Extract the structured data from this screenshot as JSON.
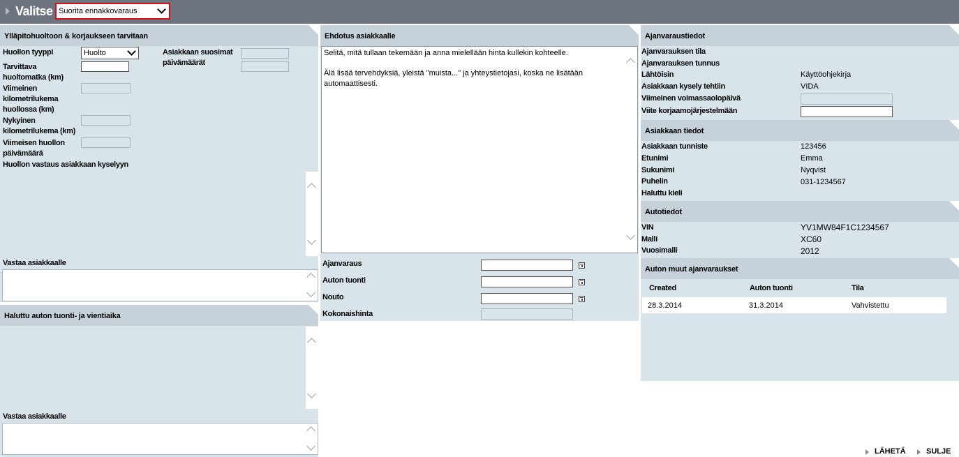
{
  "header": {
    "title": "Valitse",
    "select_value": "Suorita ennakkovaraus"
  },
  "maintenance": {
    "title": "Ylläpitohuoltoon & korjaukseen tarvitaan",
    "service_type_label": "Huollon tyyppi",
    "service_type_value": "Huolto",
    "required_km_label": "Tarvittava huoltomatka (km)",
    "last_km_label": "Viimeinen kilometrilukema huollossa (km)",
    "current_km_label": "Nykyinen kilometrilukema (km)",
    "last_date_label": "Viimeisen huollon päivämäärä",
    "preferred_dates_label": "Asiakkaan suosimat päivämäärät",
    "response_label": "Huollon vastaus asiakkaan kyselyyn",
    "reply_label": "Vastaa asiakkaalle"
  },
  "delivery": {
    "title": "Haluttu auton tuonti- ja vientiaika",
    "reply_label": "Vastaa asiakkaalle"
  },
  "proposal": {
    "title": "Ehdotus asiakkaalle",
    "text_line1": "Selitä, mitä tullaan tekemään ja anna mielellään hinta kullekin kohteelle.",
    "text_line2": "Älä lisää tervehdyksiä, yleistä \"muista...\" ja yhteystietojasi, koska ne lisätään automaattisesti.",
    "booking_label": "Ajanvaraus",
    "dropoff_label": "Auton tuonti",
    "pickup_label": "Nouto",
    "total_label": "Kokonaishinta"
  },
  "booking_info": {
    "title": "Ajanvaraustiedot",
    "status_label": "Ajanvarauksen tila",
    "id_label": "Ajanvarauksen tunnus",
    "source_label": "Lähtöisin",
    "source_value": "Käyttöohjekirja",
    "query_label": "Asiakkaan kysely tehtiin",
    "query_value": "VIDA",
    "expiry_label": "Viimeinen voimassaolopäivä",
    "ref_label": "Viite korjaamojärjestelmään"
  },
  "customer": {
    "title": "Asiakkaan tiedot",
    "id_label": "Asiakkaan tunniste",
    "id_value": "123456",
    "first_label": "Etunimi",
    "first_value": "Emma",
    "last_label": "Sukunimi",
    "last_value": "Nyqvist",
    "phone_label": "Puhelin",
    "phone_value": "031-1234567",
    "lang_label": "Haluttu kieli"
  },
  "car": {
    "title": "Autotiedot",
    "vin_label": "VIN",
    "vin_value": "YV1MW84F1C1234567",
    "model_label": "Malli",
    "model_value": "XC60",
    "year_label": "Vuosimalli",
    "year_value": "2012"
  },
  "other_bookings": {
    "title": "Auton muut ajanvaraukset",
    "headers": [
      "Created",
      "Auton tuonti",
      "Tila"
    ],
    "rows": [
      [
        "28.3.2014",
        "31.3.2014",
        "Vahvistettu"
      ]
    ]
  },
  "footer": {
    "send_label": "LÄHETÄ",
    "close_label": "SULJE"
  }
}
